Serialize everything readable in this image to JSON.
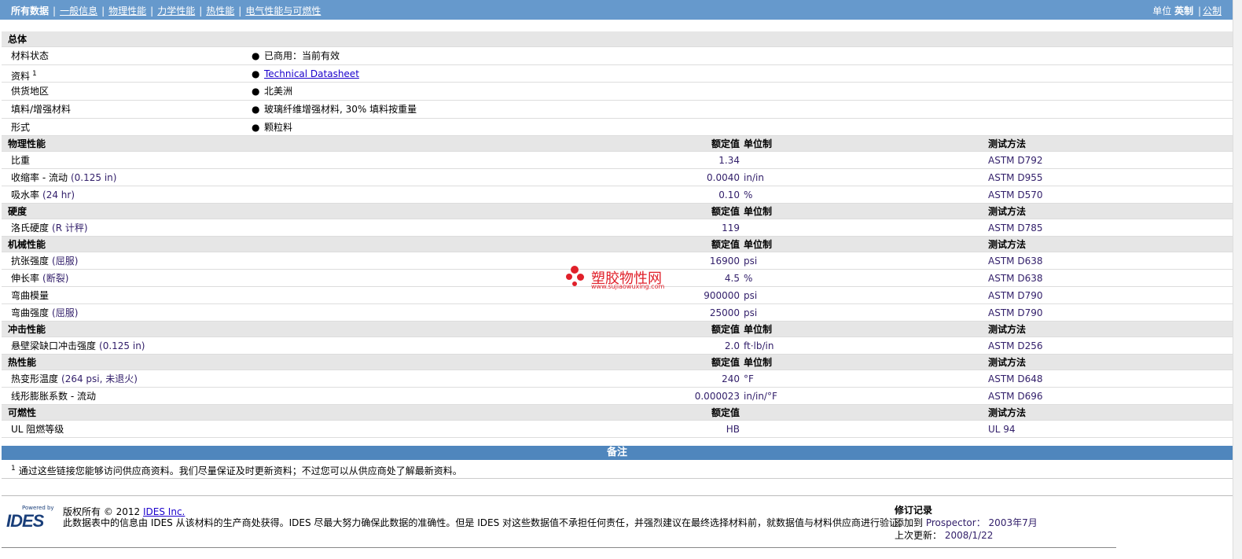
{
  "nav": {
    "items": [
      {
        "label": "所有数据"
      },
      {
        "label": "一般信息"
      },
      {
        "label": "物理性能"
      },
      {
        "label": "力学性能"
      },
      {
        "label": "热性能"
      },
      {
        "label": "电气性能与可燃性"
      }
    ],
    "units_label": "单位",
    "units_imperial": "英制",
    "units_metric": "公制",
    "separator": "|"
  },
  "general": {
    "title": "总体",
    "rows": [
      {
        "name": "材料状态",
        "value": "已商用：当前有效"
      },
      {
        "name": "资料",
        "sup": "1",
        "link": "Technical Datasheet"
      },
      {
        "name": "供货地区",
        "value": "北美洲"
      },
      {
        "name": "填料/增强材料",
        "value": "玻璃纤维增强材料, 30% 填料按重量"
      },
      {
        "name": "形式",
        "value": "颗粒料"
      }
    ],
    "bullet": "●"
  },
  "headers": {
    "nominal": "额定值",
    "unit": "单位制",
    "test": "测试方法"
  },
  "sections": [
    {
      "title": "物理性能",
      "rows": [
        {
          "name": "比重",
          "cond": "",
          "value": "1.34",
          "unit": "",
          "test": "ASTM D792"
        },
        {
          "name": "收缩率  - 流动",
          "cond": "(0.125 in)",
          "value": "0.0040",
          "unit": "in/in",
          "test": "ASTM D955"
        },
        {
          "name": "吸水率",
          "cond": "(24 hr)",
          "value": "0.10",
          "unit": "%",
          "test": "ASTM D570"
        }
      ]
    },
    {
      "title": "硬度",
      "rows": [
        {
          "name": "洛氏硬度",
          "cond": "(R 计秤)",
          "value": "119",
          "unit": "",
          "test": "ASTM D785"
        }
      ]
    },
    {
      "title": "机械性能",
      "rows": [
        {
          "name": "抗张强度",
          "cond": "(屈服)",
          "value": "16900",
          "unit": "psi",
          "test": "ASTM D638"
        },
        {
          "name": "伸长率",
          "cond": "(断裂)",
          "value": "4.5",
          "unit": "%",
          "test": "ASTM D638"
        },
        {
          "name": "弯曲模量",
          "cond": "",
          "value": "900000",
          "unit": "psi",
          "test": "ASTM D790"
        },
        {
          "name": "弯曲强度",
          "cond": "(屈服)",
          "value": "25000",
          "unit": "psi",
          "test": "ASTM D790"
        }
      ]
    },
    {
      "title": "冲击性能",
      "rows": [
        {
          "name": "悬壁梁缺口冲击强度",
          "cond": "(0.125 in)",
          "value": "2.0",
          "unit": "ft·lb/in",
          "test": "ASTM D256"
        }
      ]
    },
    {
      "title": "热性能",
      "rows": [
        {
          "name": "热变形温度",
          "cond": "(264 psi, 未退火)",
          "value": "240",
          "unit": "°F",
          "test": "ASTM D648"
        },
        {
          "name": "线形膨胀系数  - 流动",
          "cond": "",
          "value": "0.000023",
          "unit": "in/in/°F",
          "test": "ASTM D696"
        }
      ]
    },
    {
      "title": "可燃性",
      "nounit": true,
      "rows": [
        {
          "name": "UL 阻燃等级",
          "cond": "",
          "value": "HB",
          "unit": "",
          "test": "UL 94"
        }
      ]
    }
  ],
  "notes": {
    "title": "备注",
    "sup": "1",
    "text": "通过这些链接您能够访问供应商资料。我们尽量保证及时更新资料；不过您可以从供应商处了解最新资料。"
  },
  "footer": {
    "powered_by": "Powered by",
    "logo": "IDES",
    "copyright": "版权所有 © 2012",
    "company_link": "IDES Inc.",
    "disclaimer": "此数据表中的信息由 IDES 从该材料的生产商处获得。IDES 尽最大努力确保此数据的准确性。但是 IDES 对这些数据值不承担任何责任，并强烈建议在最终选择材料前，就数据值与材料供应商进行验证。",
    "rev_title": "修订记录",
    "added_label": "添加到",
    "added_app": "Prospector：",
    "added_date": "2003年7月",
    "updated_label": "上次更新：",
    "updated_date": "2008/1/22"
  },
  "watermark": {
    "text": "塑胶物性网",
    "url": "www.sujiaowuxing.com"
  }
}
